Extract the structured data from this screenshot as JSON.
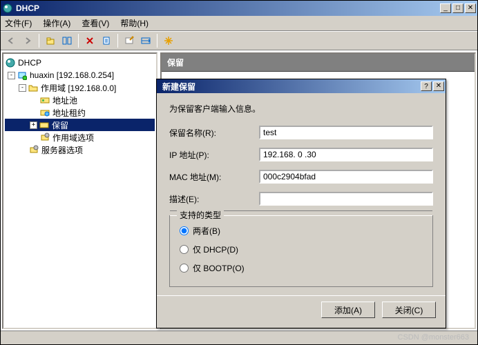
{
  "window": {
    "title": "DHCP"
  },
  "menu": {
    "file": "文件(F)",
    "action": "操作(A)",
    "view": "查看(V)",
    "help": "帮助(H)"
  },
  "tree": {
    "root": "DHCP",
    "server": "huaxin [192.168.0.254]",
    "scope": "作用域 [192.168.0.0]",
    "pool": "地址池",
    "leases": "地址租约",
    "reservations": "保留",
    "scopeoptions": "作用域选项",
    "serveroptions": "服务器选项"
  },
  "rightpane": {
    "header": "保留"
  },
  "dialog": {
    "title": "新建保留",
    "intro": "为保留客户端输入信息。",
    "labels": {
      "name": "保留名称(R):",
      "ip": "IP 地址(P):",
      "mac": "MAC 地址(M):",
      "desc": "描述(E):"
    },
    "values": {
      "name": "test",
      "ip": "192.168. 0 .30",
      "mac": "000c2904bfad",
      "desc": ""
    },
    "group": {
      "title": "支持的类型",
      "both": "两者(B)",
      "dhcp": "仅 DHCP(D)",
      "bootp": "仅 BOOTP(O)",
      "selected": "both"
    },
    "buttons": {
      "add": "添加(A)",
      "close": "关闭(C)"
    }
  },
  "watermark": "CSDN @monster663"
}
